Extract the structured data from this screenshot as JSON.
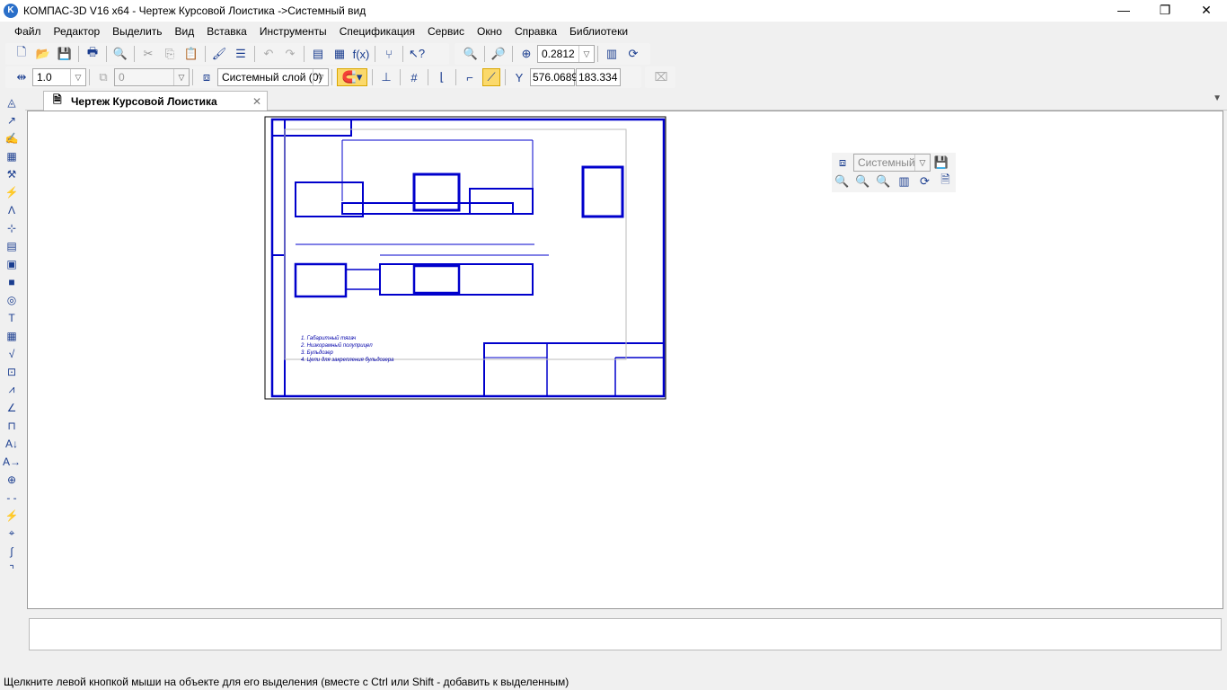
{
  "window": {
    "title": "КОМПАС-3D V16  x64 - Чертеж Курсовой Лоистика ->Системный вид",
    "logo": "K"
  },
  "menu": [
    "Файл",
    "Редактор",
    "Выделить",
    "Вид",
    "Вставка",
    "Инструменты",
    "Спецификация",
    "Сервис",
    "Окно",
    "Справка",
    "Библиотеки"
  ],
  "toolbar": {
    "zoom_value": "0.2812",
    "step_value": "1.0",
    "angle_value": "0",
    "layer_value": "Системный слой (0)",
    "coord_x": "576.0689",
    "coord_y": "183.334"
  },
  "document_tab": {
    "label": "Чертеж Курсовой Лоистика"
  },
  "floating_panel": {
    "view_value": "Системный"
  },
  "drawing": {
    "notes": [
      "1. Габаритный тягач",
      "2. Низкорамный полуприцеп",
      "3. Бульдозер",
      "4. Цепи для закрепления бульдозера"
    ]
  },
  "statusbar": {
    "hint": "Щелкните левой кнопкой мыши на объекте для его выделения (вместе с Ctrl или Shift - добавить к выделенным)"
  },
  "colors": {
    "drawing_lines": "#0000cc",
    "highlight": "#fbd96b"
  }
}
